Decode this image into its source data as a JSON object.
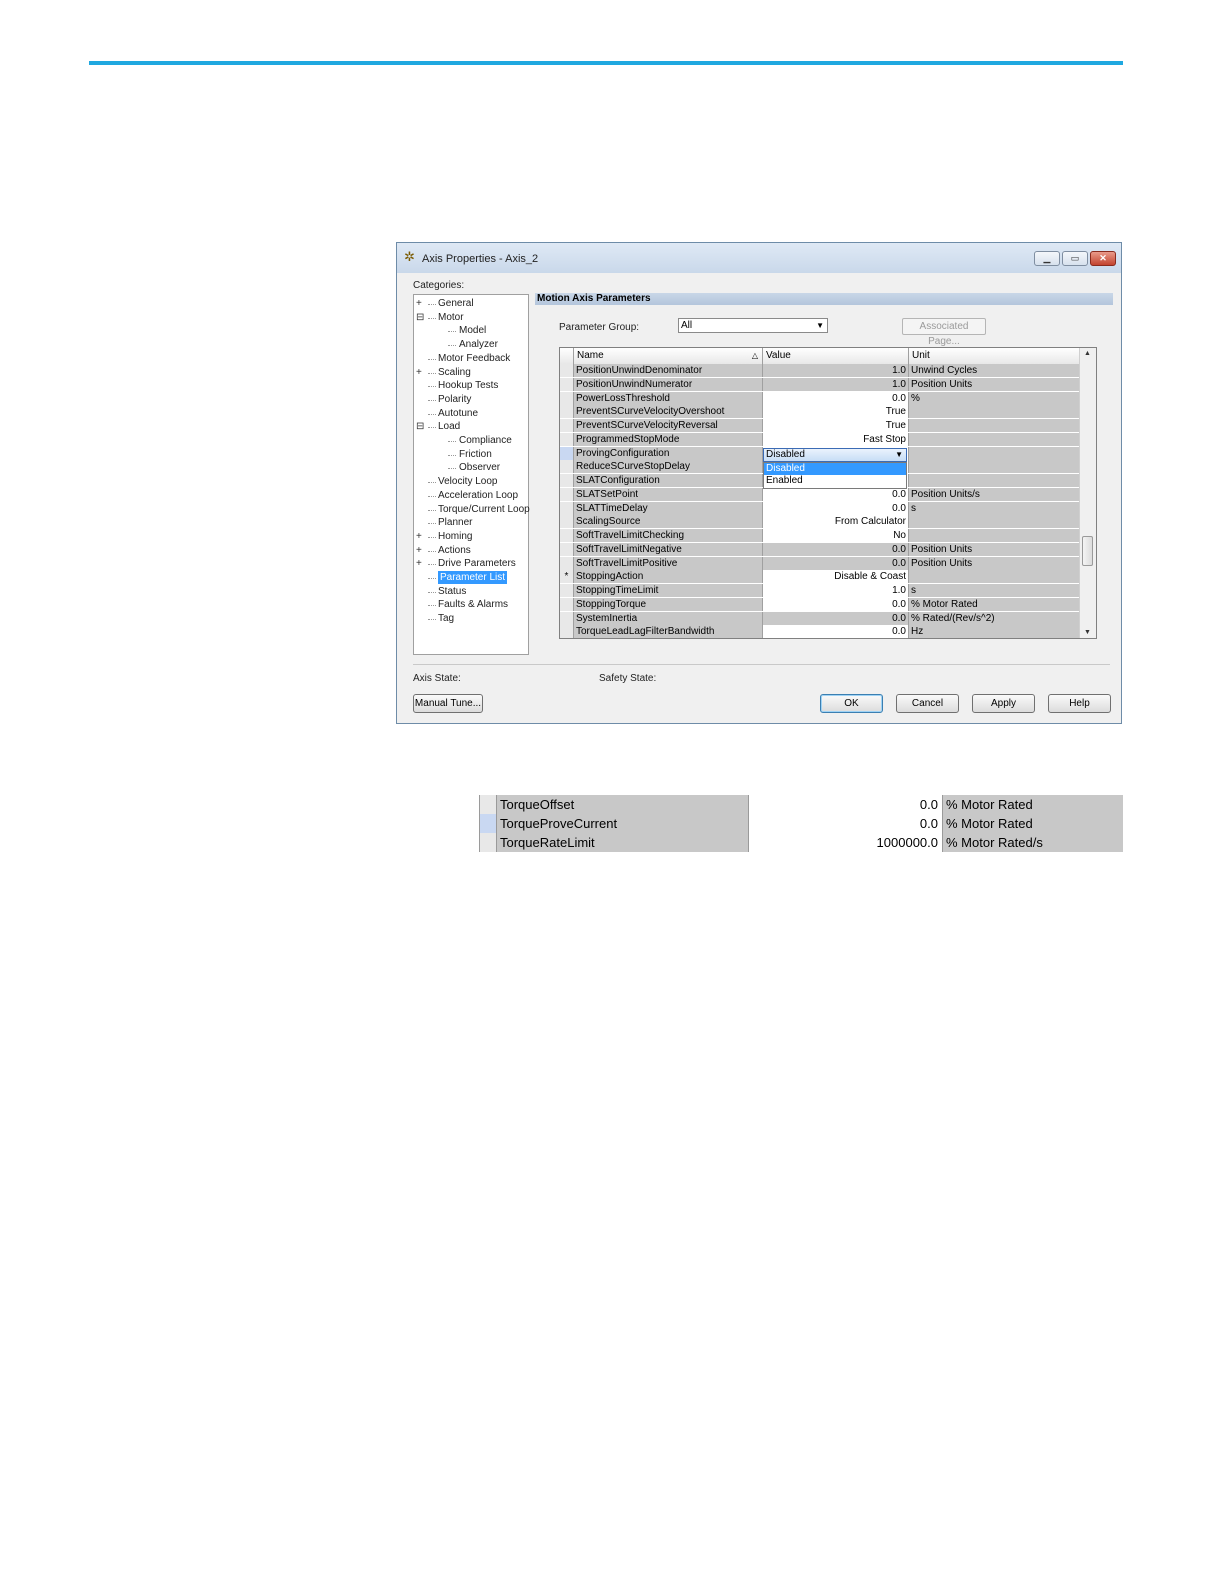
{
  "dialog": {
    "title": "Axis Properties - Axis_2",
    "categories_label": "Categories:",
    "section_title": "Motion Axis Parameters",
    "parameter_group_label": "Parameter Group:",
    "parameter_group_value": "All",
    "associated_page_label": "Associated Page...",
    "grid_headers": {
      "name": "Name",
      "value": "Value",
      "unit": "Unit"
    },
    "rows": [
      {
        "marker": "",
        "name": "PositionUnwindDenominator",
        "value": "1.0",
        "unit": "Unwind Cycles",
        "editable": false
      },
      {
        "marker": "",
        "name": "PositionUnwindNumerator",
        "value": "1.0",
        "unit": "Position Units",
        "editable": false
      },
      {
        "marker": "",
        "name": "PowerLossThreshold",
        "value": "0.0",
        "unit": "%",
        "editable": true
      },
      {
        "marker": "",
        "name": "PreventSCurveVelocityOvershoot",
        "value": "True",
        "unit": "",
        "editable": true
      },
      {
        "marker": "",
        "name": "PreventSCurveVelocityReversal",
        "value": "True",
        "unit": "",
        "editable": true
      },
      {
        "marker": "",
        "name": "ProgrammedStopMode",
        "value": "Fast Stop",
        "unit": "",
        "editable": true
      },
      {
        "marker": "",
        "name": "ProvingConfiguration",
        "value": "",
        "unit": "",
        "editable": true
      },
      {
        "marker": "",
        "name": "ReduceSCurveStopDelay",
        "value": "",
        "unit": "",
        "editable": true
      },
      {
        "marker": "",
        "name": "SLATConfiguration",
        "value": "",
        "unit": "",
        "editable": true
      },
      {
        "marker": "",
        "name": "SLATSetPoint",
        "value": "0.0",
        "unit": "Position Units/s",
        "editable": true
      },
      {
        "marker": "",
        "name": "SLATTimeDelay",
        "value": "0.0",
        "unit": "s",
        "editable": true
      },
      {
        "marker": "",
        "name": "ScalingSource",
        "value": "From Calculator",
        "unit": "",
        "editable": true
      },
      {
        "marker": "",
        "name": "SoftTravelLimitChecking",
        "value": "No",
        "unit": "",
        "editable": true
      },
      {
        "marker": "",
        "name": "SoftTravelLimitNegative",
        "value": "0.0",
        "unit": "Position Units",
        "editable": false
      },
      {
        "marker": "",
        "name": "SoftTravelLimitPositive",
        "value": "0.0",
        "unit": "Position Units",
        "editable": false
      },
      {
        "marker": "*",
        "name": "StoppingAction",
        "value": "Disable & Coast",
        "unit": "",
        "editable": true
      },
      {
        "marker": "",
        "name": "StoppingTimeLimit",
        "value": "1.0",
        "unit": "s",
        "editable": true
      },
      {
        "marker": "",
        "name": "StoppingTorque",
        "value": "0.0",
        "unit": "% Motor Rated",
        "editable": true
      },
      {
        "marker": "",
        "name": "SystemInertia",
        "value": "0.0",
        "unit": "% Rated/(Rev/s^2)",
        "editable": false
      },
      {
        "marker": "",
        "name": "TorqueLeadLagFilterBandwidth",
        "value": "0.0",
        "unit": "Hz",
        "editable": true
      }
    ],
    "dropdown": {
      "current": "Disabled",
      "options": [
        "Disabled",
        "Enabled"
      ],
      "selected_index": 0
    },
    "axis_state_label": "Axis State:",
    "safety_state_label": "Safety State:",
    "buttons": {
      "manual_tune": "Manual Tune...",
      "ok": "OK",
      "cancel": "Cancel",
      "apply": "Apply",
      "help": "Help"
    },
    "tree": [
      {
        "label": "General",
        "level": 0,
        "expander": "+"
      },
      {
        "label": "Motor",
        "level": 0,
        "expander": "-"
      },
      {
        "label": "Model",
        "level": 1,
        "expander": ""
      },
      {
        "label": "Analyzer",
        "level": 1,
        "expander": ""
      },
      {
        "label": "Motor Feedback",
        "level": 0,
        "expander": ""
      },
      {
        "label": "Scaling",
        "level": 0,
        "expander": "+"
      },
      {
        "label": "Hookup Tests",
        "level": 0,
        "expander": ""
      },
      {
        "label": "Polarity",
        "level": 0,
        "expander": ""
      },
      {
        "label": "Autotune",
        "level": 0,
        "expander": ""
      },
      {
        "label": "Load",
        "level": 0,
        "expander": "-"
      },
      {
        "label": "Compliance",
        "level": 1,
        "expander": ""
      },
      {
        "label": "Friction",
        "level": 1,
        "expander": ""
      },
      {
        "label": "Observer",
        "level": 1,
        "expander": ""
      },
      {
        "label": "Velocity Loop",
        "level": 0,
        "expander": ""
      },
      {
        "label": "Acceleration Loop",
        "level": 0,
        "expander": ""
      },
      {
        "label": "Torque/Current Loop",
        "level": 0,
        "expander": ""
      },
      {
        "label": "Planner",
        "level": 0,
        "expander": ""
      },
      {
        "label": "Homing",
        "level": 0,
        "expander": "+"
      },
      {
        "label": "Actions",
        "level": 0,
        "expander": "+"
      },
      {
        "label": "Drive Parameters",
        "level": 0,
        "expander": "+"
      },
      {
        "label": "Parameter List",
        "level": 0,
        "expander": "",
        "selected": true
      },
      {
        "label": "Status",
        "level": 0,
        "expander": ""
      },
      {
        "label": "Faults & Alarms",
        "level": 0,
        "expander": ""
      },
      {
        "label": "Tag",
        "level": 0,
        "expander": ""
      }
    ]
  },
  "snippet": {
    "rows": [
      {
        "name": "TorqueOffset",
        "value": "0.0",
        "unit": "% Motor Rated",
        "active": false
      },
      {
        "name": "TorqueProveCurrent",
        "value": "0.0",
        "unit": "% Motor Rated",
        "active": true
      },
      {
        "name": "TorqueRateLimit",
        "value": "1000000.0",
        "unit": "% Motor Rated/s",
        "active": false
      }
    ]
  },
  "colors": {
    "accent_rule": "#1fa8e0",
    "selection": "#3399ff",
    "readonly_cell": "#c8c8c8"
  }
}
